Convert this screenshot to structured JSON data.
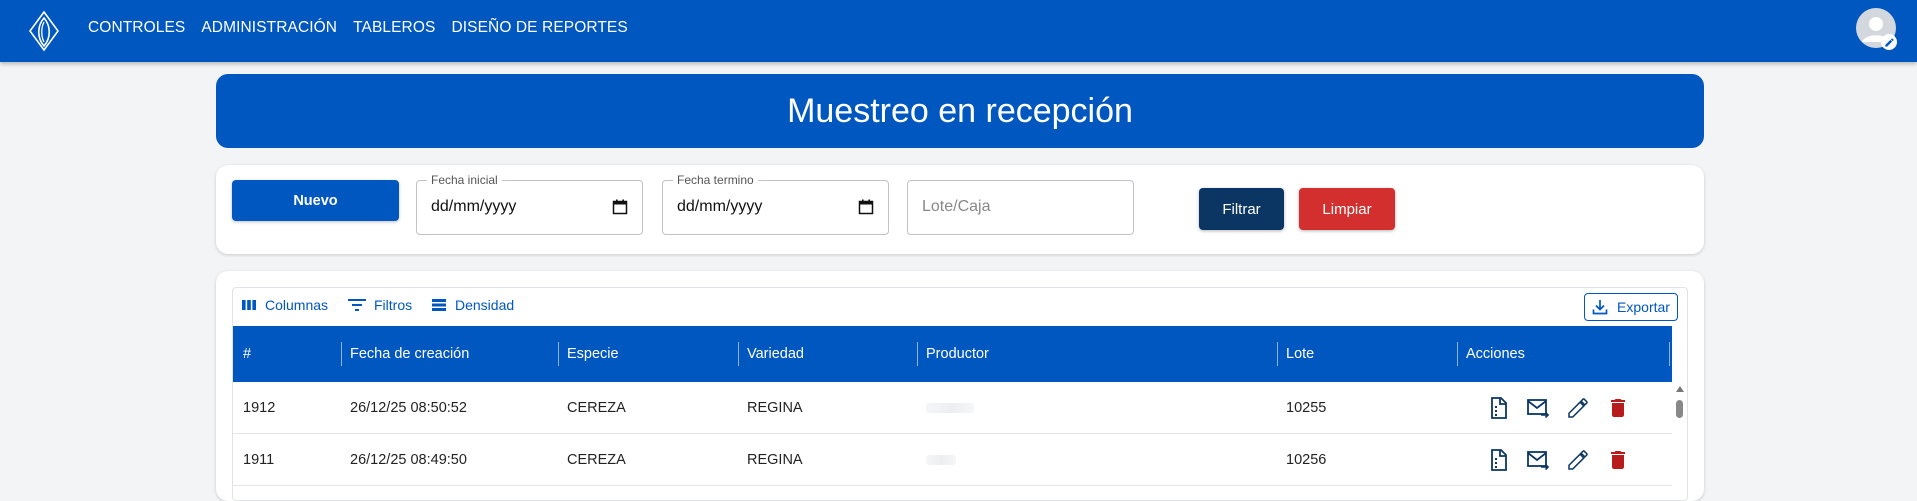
{
  "nav": {
    "items": [
      "CONTROLES",
      "ADMINISTRACIÓN",
      "TABLEROS",
      "DISEÑO DE REPORTES"
    ]
  },
  "page": {
    "title": "Muestreo en recepción"
  },
  "filters": {
    "new_label": "Nuevo",
    "start_date_label": "Fecha inicial",
    "start_date_value": "dd/mm/yyyy",
    "end_date_label": "Fecha termino",
    "end_date_value": "dd/mm/yyyy",
    "lot_placeholder": "Lote/Caja",
    "filter_label": "Filtrar",
    "clear_label": "Limpiar"
  },
  "toolbar": {
    "columns_label": "Columnas",
    "filters_label": "Filtros",
    "density_label": "Densidad",
    "export_label": "Exportar"
  },
  "table": {
    "headers": [
      "#",
      "Fecha de creación",
      "Especie",
      "Variedad",
      "Productor",
      "Lote",
      "Acciones"
    ],
    "rows": [
      {
        "id": "1912",
        "fecha": "26/12/25 08:50:52",
        "especie": "CEREZA",
        "variedad": "REGINA",
        "productor": "",
        "lote": "10255"
      },
      {
        "id": "1911",
        "fecha": "26/12/25 08:49:50",
        "especie": "CEREZA",
        "variedad": "REGINA",
        "productor": "",
        "lote": "10256"
      }
    ],
    "actions": [
      "report-icon",
      "email-forward-icon",
      "edit-icon",
      "delete-icon"
    ]
  },
  "colors": {
    "primary": "#0057bf",
    "dark_button": "#0b3663",
    "danger": "#d32f2f",
    "action_icon": "#0b3663",
    "delete_icon": "#b71c1c"
  }
}
